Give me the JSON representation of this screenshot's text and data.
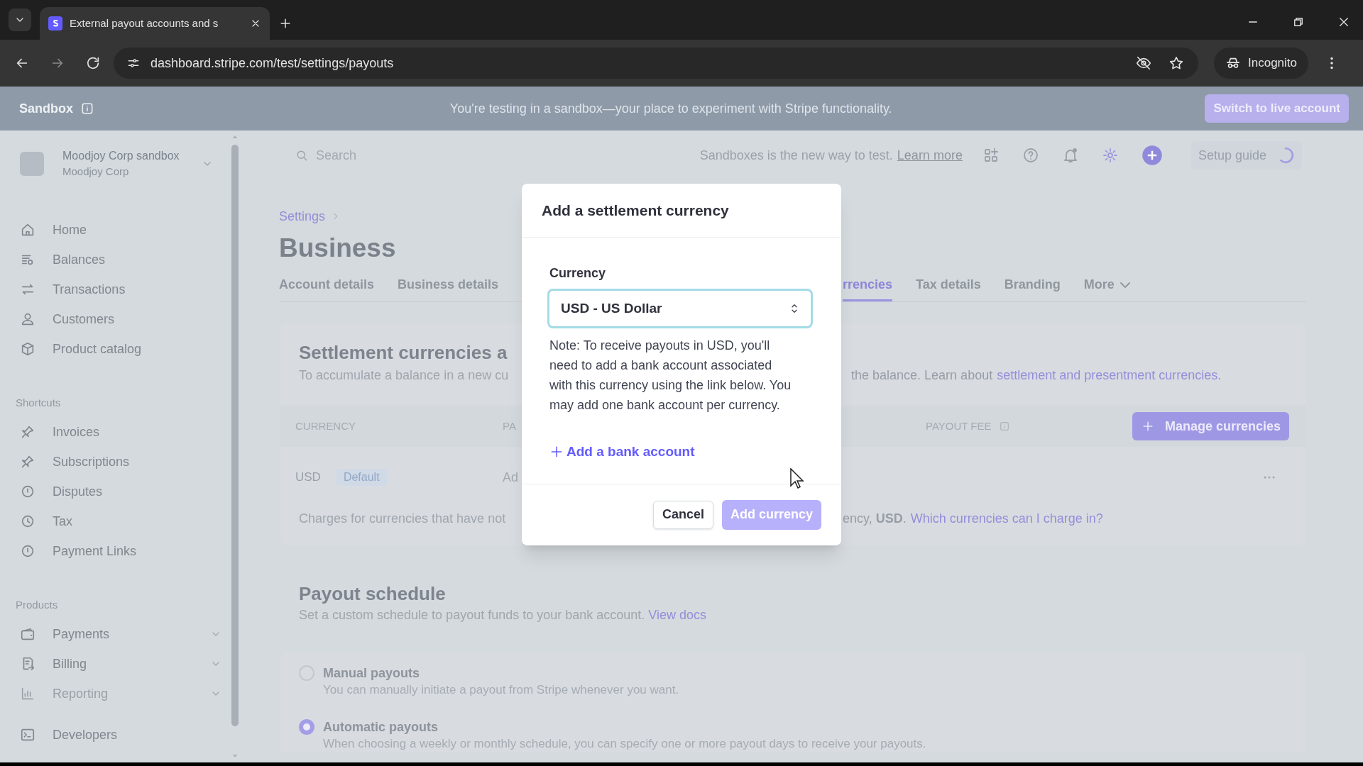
{
  "browser": {
    "tab_title": "External payout accounts and s",
    "url": "dashboard.stripe.com/test/settings/payouts",
    "profile": "Incognito"
  },
  "sandbox_banner": {
    "label": "Sandbox",
    "message": "You're testing in a sandbox—your place to experiment with Stripe functionality.",
    "button": "Switch to live account"
  },
  "sidebar": {
    "account_name": "Moodjoy Corp sandbox",
    "account_org": "Moodjoy Corp",
    "sections": [
      {
        "items": [
          {
            "label": "Home",
            "kind": "link",
            "faded": false
          },
          {
            "label": "Balances",
            "kind": "link",
            "faded": false
          },
          {
            "label": "Transactions",
            "kind": "link",
            "faded": false
          },
          {
            "label": "Customers",
            "kind": "link",
            "faded": false
          },
          {
            "label": "Product catalog",
            "kind": "link",
            "faded": false
          }
        ]
      },
      {
        "heading": "Shortcuts",
        "items": [
          {
            "label": "Invoices",
            "kind": "link",
            "faded": false
          },
          {
            "label": "Subscriptions",
            "kind": "link",
            "faded": false
          },
          {
            "label": "Disputes",
            "kind": "link",
            "faded": false
          },
          {
            "label": "Tax",
            "kind": "link",
            "faded": false
          },
          {
            "label": "Payment Links",
            "kind": "link",
            "faded": false
          }
        ]
      },
      {
        "heading": "Products",
        "items": [
          {
            "label": "Payments",
            "kind": "group",
            "expanded": false,
            "faded": false
          },
          {
            "label": "Billing",
            "kind": "group",
            "expanded": false,
            "faded": false
          },
          {
            "label": "Reporting",
            "kind": "group",
            "expanded": false,
            "faded": true
          }
        ]
      },
      {
        "items": [
          {
            "label": "Developers",
            "kind": "link",
            "faded": false
          }
        ]
      }
    ]
  },
  "topbar": {
    "search_placeholder": "Search",
    "notice": "Sandboxes is the new way to test.",
    "notice_link": "Learn more",
    "setup_guide": "Setup guide"
  },
  "page": {
    "breadcrumb": "Settings",
    "title": "Business",
    "tabs": {
      "left": [
        {
          "label": "Account details",
          "kind": "tab",
          "selected": false
        },
        {
          "label": "Business details",
          "kind": "tab",
          "selected": false
        }
      ],
      "right": [
        {
          "label": "rrencies",
          "kind": "tab",
          "selected": true
        },
        {
          "label": "Tax details",
          "kind": "tab",
          "selected": false
        },
        {
          "label": "Branding",
          "kind": "tab",
          "selected": false
        },
        {
          "label": "More",
          "kind": "dropdown",
          "selected": false
        }
      ]
    },
    "settlement": {
      "heading": "Settlement currencies a",
      "description_left": "To accumulate a balance in a new cu",
      "description_right": "the balance. Learn about",
      "description_link": "settlement and presentment currencies.",
      "columns": [
        {
          "label": "CURRENCY"
        },
        {
          "label": "PA"
        },
        {
          "label": "PAYOUT FEE",
          "info": true
        }
      ],
      "manage_button": "Manage currencies",
      "rows": [
        {
          "currency": "USD",
          "badge": "Default",
          "column_2": "Ad"
        }
      ],
      "note_left": "Charges for currencies that have not",
      "note_right": "ency, **USD**.",
      "note_link": "Which currencies can I charge in?"
    },
    "payout_schedule": {
      "title": "Payout schedule",
      "description": "Set a custom schedule to payout funds to your bank account.",
      "link": "View docs",
      "options": [
        {
          "label": "Manual payouts",
          "description": "You can manually initiate a payout from Stripe whenever you want.",
          "selected": false
        },
        {
          "label": "Automatic payouts",
          "description": "When choosing a weekly or monthly schedule, you can specify one or more payout days to receive your payouts.",
          "selected": true
        }
      ]
    }
  },
  "dialog": {
    "title": "Add a settlement currency",
    "field_label": "Currency",
    "select_value": "USD - US Dollar",
    "note": "Note: To receive payouts in USD, you'll need to add a bank account associated with this currency using the link below. You may add one bank account per currency.",
    "add_link": "Add a bank account",
    "cancel": "Cancel",
    "confirm": {
      "label": "Add currency",
      "disabled": true
    }
  }
}
